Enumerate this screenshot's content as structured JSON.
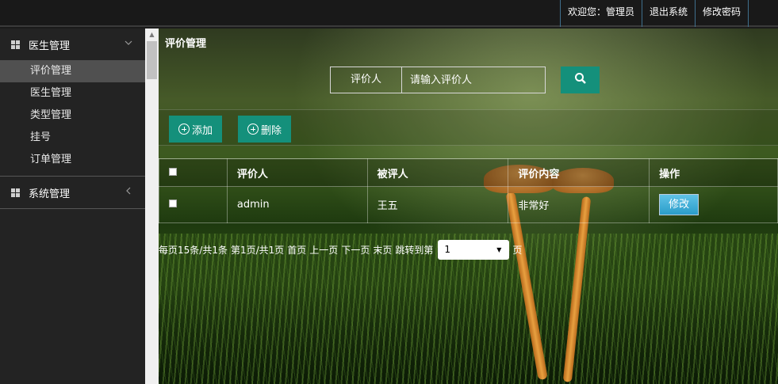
{
  "header": {
    "welcome": "欢迎您：管理员",
    "logout": "退出系统",
    "change_password": "修改密码"
  },
  "sidebar": {
    "groups": [
      {
        "label": "医生管理",
        "expanded": true,
        "arrow": "chevron-down",
        "items": [
          "评价管理",
          "医生管理",
          "类型管理",
          "挂号",
          "订单管理"
        ],
        "active": 0
      },
      {
        "label": "系统管理",
        "expanded": false,
        "arrow": "chevron-left"
      }
    ]
  },
  "main": {
    "title": "评价管理",
    "search": {
      "label": "评价人",
      "placeholder": "请输入评价人",
      "button_icon": "search-icon"
    },
    "actions": {
      "add": "添加",
      "delete": "删除"
    },
    "table": {
      "headers": [
        "评价人",
        "被评人",
        "评价内容",
        "操作"
      ],
      "rows": [
        {
          "reviewer": "admin",
          "reviewee": "王五",
          "content": "非常好",
          "action": "修改"
        }
      ]
    },
    "pager": {
      "per_page": "每页15条/共1条",
      "page_of": "第1页/共1页",
      "first": "首页",
      "prev": "上一页",
      "next": "下一页",
      "last": "末页",
      "jump_prefix": "跳转到第",
      "jump_value": "1",
      "jump_suffix": "页"
    }
  },
  "colors": {
    "accent": "#14907b",
    "edit_button": "#2a9dc9",
    "topbar": "#191919",
    "sidebar": "#232323"
  }
}
